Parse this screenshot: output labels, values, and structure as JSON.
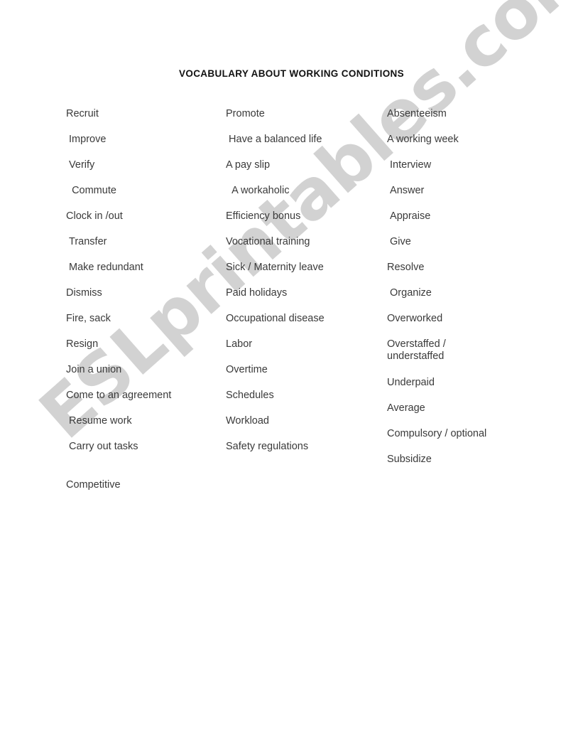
{
  "document": {
    "title": "VOCABULARY ABOUT WORKING CONDITIONS",
    "watermark": "ESLprintables.com",
    "colors": {
      "page_background": "#ffffff",
      "title_text": "#111111",
      "body_text": "#3a3a3a",
      "watermark": "#d2d2d2"
    }
  },
  "columns": [
    {
      "name": "column-1",
      "items": [
        {
          "text": "Recruit"
        },
        {
          "text": " Improve"
        },
        {
          "text": " Verify"
        },
        {
          "text": "  Commute"
        },
        {
          "text": "Clock in /out"
        },
        {
          "text": " Transfer"
        },
        {
          "text": " Make redundant"
        },
        {
          "text": "Dismiss"
        },
        {
          "text": "Fire, sack"
        },
        {
          "text": "Resign"
        },
        {
          "text": "Join a union"
        },
        {
          "text": "Come to an agreement"
        },
        {
          "text": " Resume work"
        },
        {
          "text": " Carry out tasks"
        },
        {
          "text": "Competitive",
          "gap_before": true
        }
      ]
    },
    {
      "name": "column-2",
      "items": [
        {
          "text": "Promote"
        },
        {
          "text": " Have a balanced life"
        },
        {
          "text": "A pay slip"
        },
        {
          "text": "  A workaholic"
        },
        {
          "text": "Efficiency bonus"
        },
        {
          "text": "Vocational training"
        },
        {
          "text": "Sick / Maternity leave"
        },
        {
          "text": "Paid holidays"
        },
        {
          "text": "Occupational disease"
        },
        {
          "text": "Labor"
        },
        {
          "text": "Overtime"
        },
        {
          "text": "Schedules"
        },
        {
          "text": "Workload"
        },
        {
          "text": "Safety regulations"
        }
      ]
    },
    {
      "name": "column-3",
      "items": [
        {
          "text": "Absenteeism"
        },
        {
          "text": "A working week"
        },
        {
          "text": " Interview"
        },
        {
          "text": " Answer"
        },
        {
          "text": " Appraise"
        },
        {
          "text": " Give"
        },
        {
          "text": "Resolve"
        },
        {
          "text": " Organize"
        },
        {
          "text": "Overworked"
        },
        {
          "text": "Overstaffed /\nunderstaffed",
          "wrap": true
        },
        {
          "text": "Underpaid"
        },
        {
          "text": "Average"
        },
        {
          "text": "Compulsory / optional"
        },
        {
          "text": "Subsidize"
        }
      ]
    }
  ]
}
